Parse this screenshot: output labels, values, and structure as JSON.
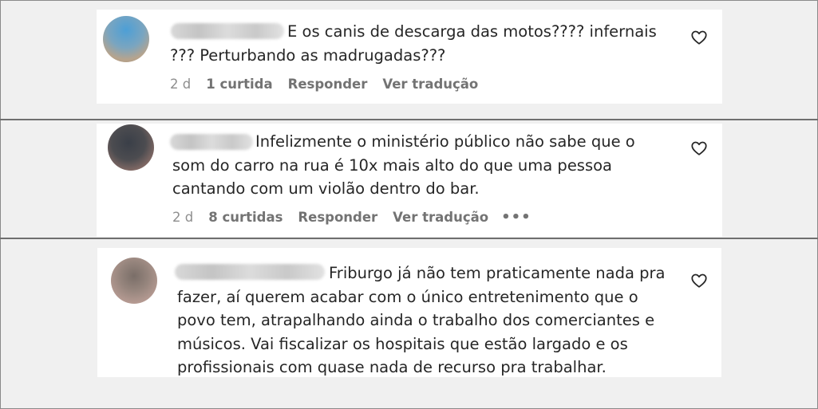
{
  "comments": [
    {
      "text": "E os canis de descarga das motos???? infernais\n??? Perturbando as madrugadas???",
      "time": "2 d",
      "likes": "1 curtida",
      "reply": "Responder",
      "translate": "Ver tradução",
      "more": ""
    },
    {
      "text": "Infelizmente o ministério público não sabe que o\nsom do carro na rua é 10x mais alto do que uma pessoa\ncantando com um violão dentro do bar.",
      "time": "2 d",
      "likes": "8 curtidas",
      "reply": "Responder",
      "translate": "Ver tradução",
      "more": "•••"
    },
    {
      "text": "Friburgo já não tem praticamente nada pra\nfazer, aí querem acabar com o único entretenimento que o\npovo tem, atrapalhando ainda o trabalho dos comerciantes e\nmúsicos. Vai fiscalizar os hospitais que estão largado e os\nprofissionais com quase nada de recurso pra trabalhar."
    }
  ],
  "icons": {
    "avatar": "avatar",
    "like": "heart-icon",
    "more": "more-options-icon"
  },
  "colors": {
    "text": "#262626",
    "meta": "#8e8e8e",
    "background": "#f0f0f0",
    "card": "#ffffff",
    "divider": "#6f6f6f"
  }
}
